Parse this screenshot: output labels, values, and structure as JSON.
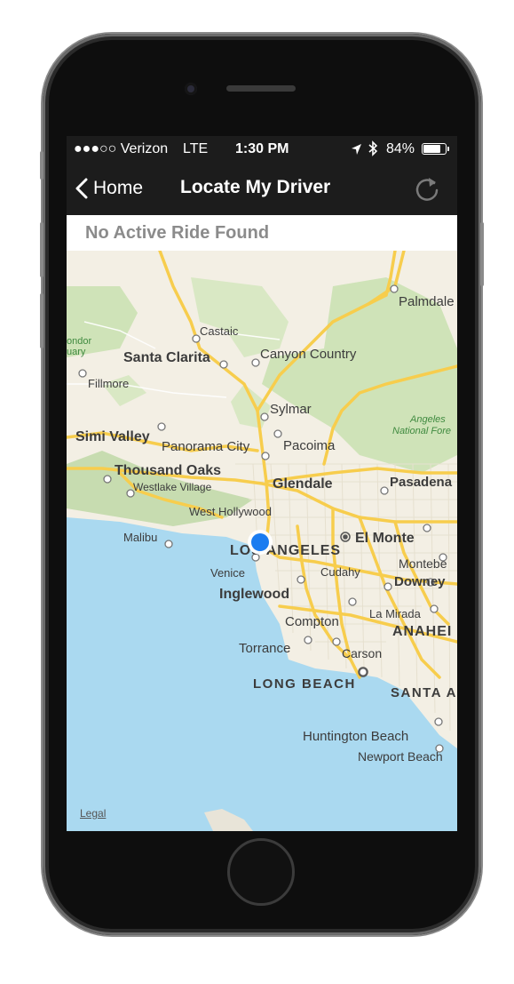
{
  "status_bar": {
    "carrier": "●●●○○ Verizon",
    "network": "LTE",
    "time": "1:30 PM",
    "battery": "84%",
    "battery_level": 0.84
  },
  "nav": {
    "back_label": "Home",
    "title": "Locate My Driver"
  },
  "banner": {
    "message": "No Active Ride Found"
  },
  "map": {
    "legal": "Legal",
    "labels": {
      "palmdale": "Palmdale",
      "castaic": "Castaic",
      "santa_clarita": "Santa Clarita",
      "canyon_country": "Canyon Country",
      "condor": "ondor",
      "condor2": "uary",
      "fillmore": "Fillmore",
      "sylmar": "Sylmar",
      "angeles1": "Angeles",
      "angeles2": "National Fore",
      "simi_valley": "Simi Valley",
      "panorama_city": "Panorama City",
      "pacoima": "Pacoima",
      "thousand_oaks": "Thousand Oaks",
      "westlake_village": "Westlake Village",
      "glendale": "Glendale",
      "pasadena": "Pasadena",
      "west_hollywood": "West Hollywood",
      "malibu": "Malibu",
      "los_angeles": "LOS ANGELES",
      "el_monte": "El Monte",
      "venice": "Venice",
      "cudahy": "Cudahy",
      "montebe": "Montebe",
      "inglewood": "Inglewood",
      "downey": "Downey",
      "compton": "Compton",
      "la_mirada": "La Mirada",
      "anaheim": "ANAHEI",
      "torrance": "Torrance",
      "carson": "Carson",
      "long_beach": "LONG BEACH",
      "santa_ana": "SANTA A",
      "huntington_beach": "Huntington Beach",
      "newport_beach": "Newport Beach"
    }
  },
  "colors": {
    "accent_location": "#1a7cf0",
    "water": "#aad9f0",
    "land": "#f3efe4",
    "park": "#cfe3b8",
    "road": "#f7cd4d"
  }
}
